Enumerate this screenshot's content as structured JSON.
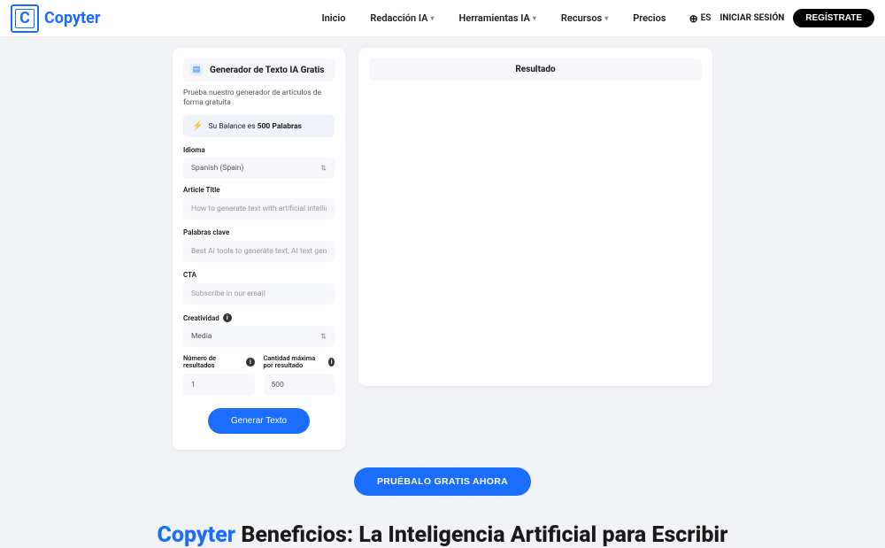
{
  "logo": {
    "letter": "C",
    "text": "Copyter"
  },
  "nav": {
    "inicio": "Inicio",
    "redaccion": "Redacción IA",
    "herramientas": "Herramientas IA",
    "recursos": "Recursos",
    "precios": "Precios"
  },
  "actions": {
    "lang": "ES",
    "login": "INICIAR SESIÓN",
    "register": "REGÍSTRATE"
  },
  "form": {
    "header_title": "Generador de Texto IA Gratis",
    "subtitle": "Prueba nuestro generador de artículos de forma gratuita",
    "balance_prefix": "Su Balance es ",
    "balance_value": "500 Palabras",
    "idioma_label": "Idioma",
    "idioma_value": "Spanish (Spain)",
    "article_label": "Article Title",
    "article_placeholder": "How to generate text with artificial intelligence",
    "keywords_label": "Palabras clave",
    "keywords_placeholder": "Best AI tools to generate text, AI text generator",
    "cta_label": "CTA",
    "cta_placeholder": "Subscribe in our email",
    "creativity_label": "Creatividad",
    "creativity_value": "Media",
    "num_results_label": "Número de resultados",
    "num_results_value": "1",
    "max_label": "Cantidad máxima por resultado",
    "max_value": "500",
    "generate_btn": "Generar Texto"
  },
  "result": {
    "title": "Resultado"
  },
  "cta_main": "PRUÉBALO GRATIS AHORA",
  "benefits": {
    "brand": "Copyter",
    "rest": " Beneficios: La Inteligencia Artificial para Escribir"
  }
}
